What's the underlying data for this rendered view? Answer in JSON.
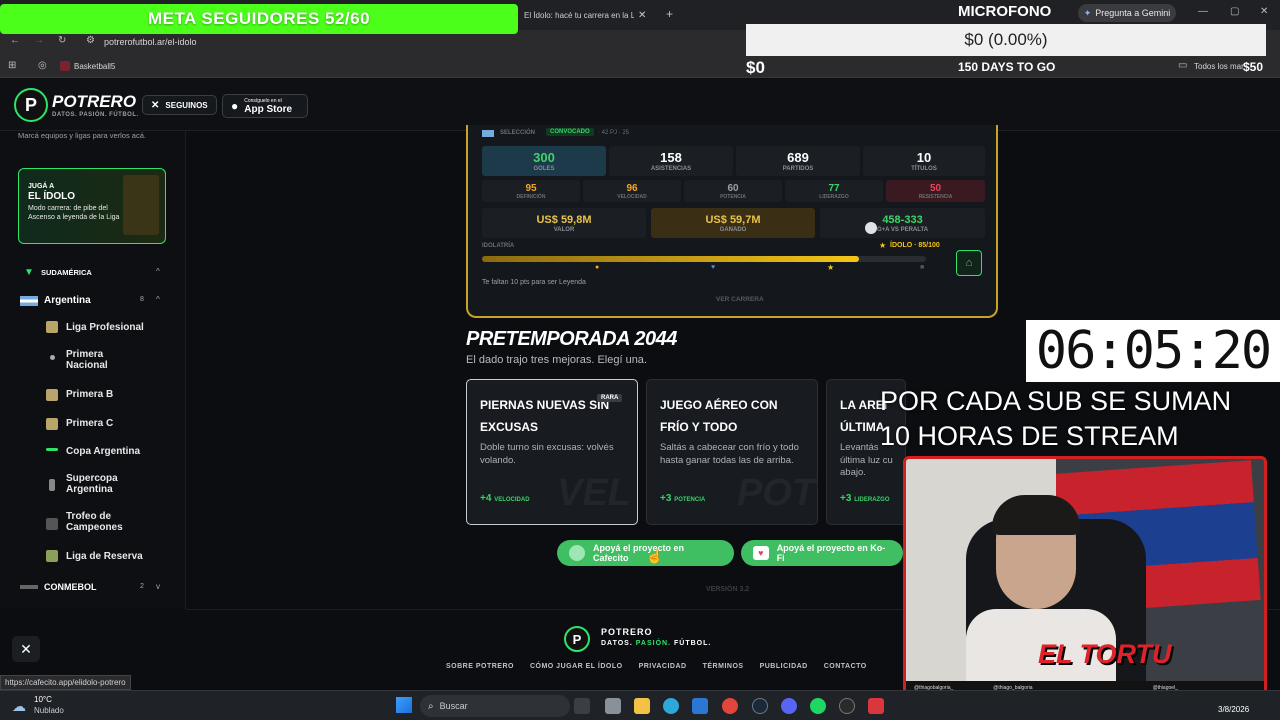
{
  "browser": {
    "tab_title": "El Ídolo: hacé tu carrera en la Li",
    "url": "potrerofutbol.ar/el-idolo",
    "bookmark": "Basketball5",
    "bookmarks_right": "Todos los mar",
    "gemini": "Pregunta a Gemini"
  },
  "overlay": {
    "banner": "META SEGUIDORES 52/60",
    "mic": "MICROFONO",
    "goal_amount": "$0 (0.00%)",
    "goal_left": "$0",
    "goal_days": "150 DAYS TO GO",
    "goal_right": "$50",
    "timer": "06:05:20",
    "sub_line1": "POR CADA SUB SE SUMAN",
    "sub_line2": "10 HORAS DE STREAM",
    "webcam_brand": "EL TORTU",
    "social_1": "@thiagobalgoria_",
    "social_2": "@thiago_balgoria",
    "social_3": "@thiagoel_"
  },
  "header": {
    "logo_name": "POTRERO",
    "logo_tag": "DATOS. PASIÓN. FÚTBOL.",
    "follow_label": "SEGUINOS",
    "appstore_small": "Consíguelo en el",
    "appstore_big": "App Store"
  },
  "sidebar": {
    "hint": "Marcá equipos y ligas para verlos acá.",
    "promo_kicker": "JUGÁ A",
    "promo_title": "EL ÍDOLO",
    "promo_text": "Modo carrera: de pibe del Ascenso a leyenda de la Liga",
    "region": "SUDAMÉRICA",
    "country": "Argentina",
    "country_count": "8",
    "leagues": [
      "Liga Profesional",
      "Primera Nacional",
      "Primera B",
      "Primera C",
      "Copa Argentina",
      "Supercopa Argentina",
      "Trofeo de Campeones",
      "Liga de Reserva"
    ],
    "conmebol": "CONMEBOL",
    "conmebol_count": "2"
  },
  "stats": {
    "seleccion": "SELECCIÓN",
    "convocado": "CONVOCADO",
    "record": "· 42 PJ · 25",
    "main": [
      {
        "value": "300",
        "label": "GOLES"
      },
      {
        "value": "158",
        "label": "ASISTENCIAS"
      },
      {
        "value": "689",
        "label": "PARTIDOS"
      },
      {
        "value": "10",
        "label": "TÍTULOS"
      }
    ],
    "attrs": [
      {
        "value": "95",
        "label": "DEFINICIÓN",
        "color": "#f5a623"
      },
      {
        "value": "96",
        "label": "VELOCIDAD",
        "color": "#f5a623"
      },
      {
        "value": "60",
        "label": "POTENCIA",
        "color": "#9aa0a6"
      },
      {
        "value": "77",
        "label": "LIDERAZGO",
        "color": "#3fd46a"
      },
      {
        "value": "50",
        "label": "RESISTENCIA",
        "color": "#e0485a"
      }
    ],
    "money": [
      {
        "value": "US$ 59,8M",
        "label": "VALOR"
      },
      {
        "value": "US$ 59,7M",
        "label": "GANADO"
      }
    ],
    "rival_value": "458-333",
    "rival_label": "G+A VS PERALTA",
    "idolatria": "IDOLATRÍA",
    "idolo": "ÍDOLO · 85/100",
    "idolo_progress": 0.85,
    "leyenda_note": "Te faltan 10 pts para ser Leyenda",
    "ver_carrera": "VER CARRERA"
  },
  "pretemporada": {
    "title": "PRETEMPORADA 2044",
    "subtitle": "El dado trajo tres mejoras. Elegí una.",
    "cards": [
      {
        "title": "PIERNAS NUEVAS SIN EXCUSAS",
        "badge": "RARA",
        "desc": "Doble turno sin excusas: volvés volando.",
        "gain": "+4",
        "stat": "VELOCIDAD",
        "bg": "VEL"
      },
      {
        "title": "JUEGO AÉREO CON FRÍO Y TODO",
        "badge": "",
        "desc": "Saltás a cabecear con frío y todo hasta ganar todas las de arriba.",
        "gain": "+3",
        "stat": "POTENCIA",
        "bg": "POT"
      },
      {
        "title": "LA AREI ÚLTIMA",
        "badge": "",
        "desc": "Levantás última luz cu abajo.",
        "gain": "+3",
        "stat": "LIDERAZGO",
        "bg": ""
      }
    ]
  },
  "support": {
    "cafecito": "Apoyá el proyecto en Cafecito",
    "kofi": "Apoyá el proyecto en Ko-Fi",
    "version": "VERSIÓN 3.2"
  },
  "footer": {
    "logo_name": "POTRERO",
    "tag_1": "DATOS.",
    "tag_2": "PASIÓN.",
    "tag_3": "FÚTBOL.",
    "links": [
      "SOBRE POTRERO",
      "CÓMO JUGAR EL ÍDOLO",
      "PRIVACIDAD",
      "TÉRMINOS",
      "PUBLICIDAD",
      "CONTACTO"
    ]
  },
  "status_url": "https://cafecito.app/elidolo-potrero",
  "taskbar": {
    "weather_temp": "10°C",
    "weather_desc": "Nublado",
    "search": "Buscar",
    "date": "3/8/2026"
  }
}
